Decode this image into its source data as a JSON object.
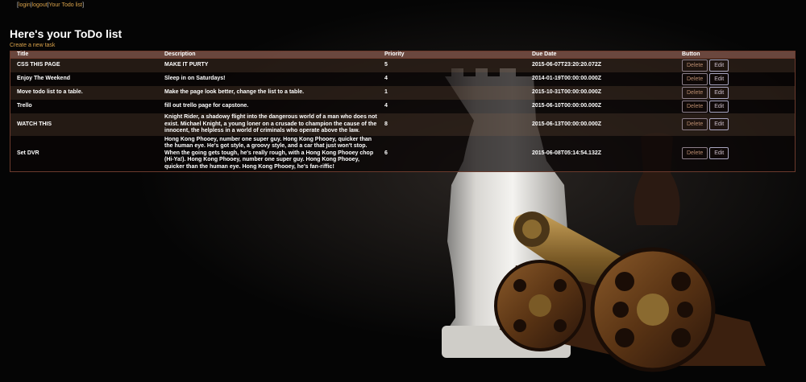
{
  "nav": {
    "login": "login",
    "logout": "logout",
    "todo_list": "Your Todo list",
    "sep": "|",
    "open": "[",
    "close": "]"
  },
  "page": {
    "title": "Here's your ToDo list",
    "create_link": "Create a new task"
  },
  "table": {
    "headers": {
      "title": "Title",
      "description": "Description",
      "priority": "Priority",
      "due_date": "Due Date",
      "button": "Button"
    },
    "rows": [
      {
        "title": "CSS THIS PAGE",
        "description": "MAKE IT PURTY",
        "priority": "5",
        "due_date": "2015-06-07T23:20:20.072Z",
        "delete": "Delete",
        "edit": "Edit"
      },
      {
        "title": "Enjoy The Weekend",
        "description": "Sleep in on Saturdays!",
        "priority": "4",
        "due_date": "2014-01-19T00:00:00.000Z",
        "delete": "Delete",
        "edit": "Edit"
      },
      {
        "title": "Move todo list to a table.",
        "description": "Make the page look better, change the list to a table.",
        "priority": "1",
        "due_date": "2015-10-31T00:00:00.000Z",
        "delete": "Delete",
        "edit": "Edit"
      },
      {
        "title": "Trello",
        "description": "fill out trello page for capstone.",
        "priority": "4",
        "due_date": "2015-06-10T00:00:00.000Z",
        "delete": "Delete",
        "edit": "Edit"
      },
      {
        "title": "WATCH THIS",
        "description": "Knight Rider, a shadowy flight into the dangerous world of a man who does not exist. Michael Knight, a young loner on a crusade to champion the cause of the innocent, the helpless in a world of criminals who operate above the law.",
        "priority": "8",
        "due_date": "2015-06-13T00:00:00.000Z",
        "delete": "Delete",
        "edit": "Edit"
      },
      {
        "title": "Set DVR",
        "description": "Hong Kong Phooey, number one super guy. Hong Kong Phooey, quicker than the human eye. He's got style, a groovy style, and a car that just won't stop. When the going gets tough, he's really rough, with a Hong Kong Phooey chop (Hi-Ya!). Hong Kong Phooey, number one super guy. Hong Kong Phooey, quicker than the human eye. Hong Kong Phooey, he's fan-riffic!",
        "priority": "6",
        "due_date": "2015-06-08T05:14:54.132Z",
        "delete": "Delete",
        "edit": "Edit"
      }
    ]
  },
  "background": {
    "subject": "chess-rook-and-cannon-photo",
    "base_color": "#050505",
    "accent_link_color": "#d9a24a"
  }
}
